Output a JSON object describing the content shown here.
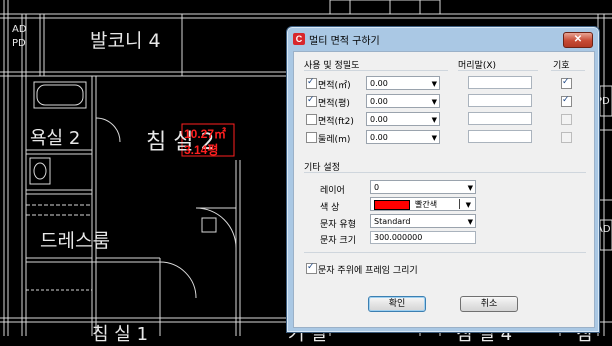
{
  "background": {
    "labels": {
      "ad_top": "AD",
      "pd_top": "PD",
      "balcony4": "발코니 4",
      "bath2": "욕실 2",
      "bedroom2": "침 실 2",
      "dress_room": "드레스룸",
      "pd_right": "PD",
      "ad_right": "AD",
      "bottom1": "침 실 1",
      "bottom2": "거 실",
      "bottom3": "침 실 4",
      "bottom4": "침"
    },
    "area_m2": "10.27㎡",
    "area_pyeong": "3.14평"
  },
  "dialog": {
    "title": "멀티 면적 구하기",
    "close_symbol": "✕",
    "headers": {
      "usage": "사용 및 정밀도",
      "suffix": "머리말(X)",
      "symbol": "기호"
    },
    "rows": [
      {
        "label": "면적(㎡)",
        "checked": true,
        "precision": "0.00",
        "suffix": "",
        "symbol_checked": true
      },
      {
        "label": "면적(평)",
        "checked": true,
        "precision": "0.00",
        "suffix": "",
        "symbol_checked": true
      },
      {
        "label": "면적(ft2)",
        "checked": false,
        "precision": "0.00",
        "suffix": "",
        "symbol_checked": false
      },
      {
        "label": "둘레(m)",
        "checked": false,
        "precision": "0.00",
        "suffix": "",
        "symbol_checked": false
      }
    ],
    "other_settings": {
      "title": "기타 설정",
      "layer_label": "레이어",
      "layer_value": "0",
      "color_label": "색 상",
      "color_name": "빨간색",
      "color_hex": "#ff0000",
      "text_style_label": "문자 유형",
      "text_style_value": "Standard",
      "text_size_label": "문자 크기",
      "text_size_value": "300.000000"
    },
    "frame_checkbox": {
      "label": "문자 주위에 프레임 그리기",
      "checked": true
    },
    "ok_label": "확인",
    "cancel_label": "취소"
  },
  "colors": {
    "title_bar": "#aac8e4",
    "cad_bg": "#000000",
    "cad_line": "#d9d9d9",
    "red": "#ff2020"
  }
}
